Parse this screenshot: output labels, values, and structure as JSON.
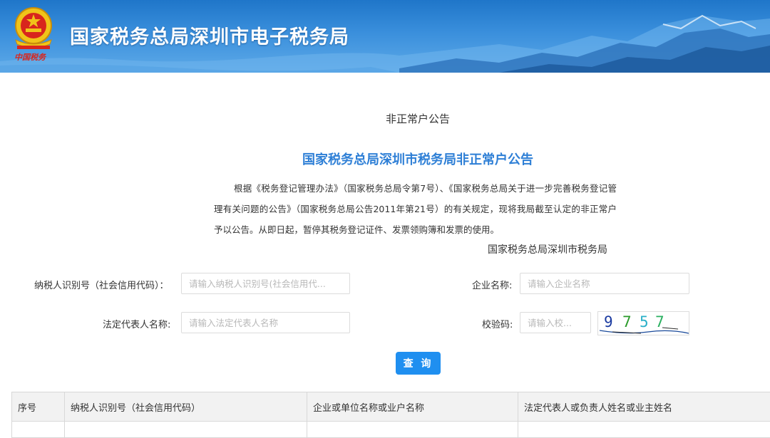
{
  "header": {
    "site_title": "国家税务总局深圳市电子税务局",
    "emblem_caption": "中国税务"
  },
  "notice": {
    "heading": "非正常户公告",
    "title": "国家税务总局深圳市税务局非正常户公告",
    "body": "根据《税务登记管理办法》（国家税务总局令第7号）、《国家税务总局关于进一步完善税务登记管理有关问题的公告》（国家税务总局公告2011年第21号）的有关规定，现将我局截至认定的非正常户予以公告。从即日起，暂停其税务登记证件、发票领购簿和发票的使用。",
    "signature": "国家税务总局深圳市税务局"
  },
  "form": {
    "taxpayer_id_label": "纳税人识别号（社会信用代码）：",
    "taxpayer_id_placeholder": "请输入纳税人识别号(社会信用代...",
    "company_name_label": "企业名称:",
    "company_name_placeholder": "请输入企业名称",
    "legal_rep_label": "法定代表人名称:",
    "legal_rep_placeholder": "请输入法定代表人名称",
    "captcha_label": "校验码:",
    "captcha_placeholder": "请输入校...",
    "captcha_chars": [
      "9",
      "7",
      "5",
      "7"
    ],
    "search_button": "查 询"
  },
  "table": {
    "columns": [
      "序号",
      "纳税人识别号（社会信用代码）",
      "企业或单位名称或业户名称",
      "法定代表人或负责人姓名或业主姓名"
    ]
  },
  "colors": {
    "title_blue": "#2e7fd6",
    "button_blue": "#1f8ff0",
    "banner_blue": "#3a8fdc"
  }
}
